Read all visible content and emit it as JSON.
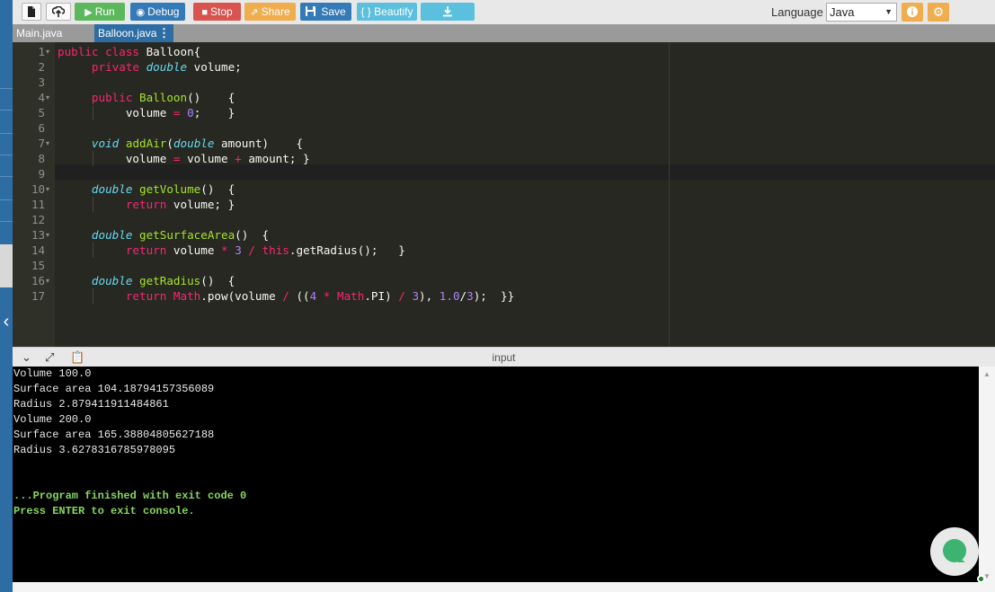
{
  "toolbar": {
    "new_file_icon": "file-icon",
    "upload_icon": "upload-icon",
    "run_label": "Run",
    "debug_label": "Debug",
    "stop_label": "Stop",
    "share_label": "Share",
    "save_label": "Save",
    "beautify_label": "{ } Beautify",
    "download_icon": "download-icon",
    "language_label": "Language",
    "language_value": "Java",
    "info_icon": "info-icon",
    "settings_icon": "gear-icon"
  },
  "tabs": [
    {
      "label": "Main.java",
      "active": false
    },
    {
      "label": "Balloon.java",
      "active": true
    }
  ],
  "editor": {
    "line_numbers": [
      "1",
      "2",
      "3",
      "4",
      "5",
      "6",
      "7",
      "8",
      "9",
      "10",
      "11",
      "12",
      "13",
      "14",
      "15",
      "16",
      "17"
    ],
    "active_line": 8
  },
  "console": {
    "title": "input",
    "output": [
      "Volume 100.0",
      "Surface area 104.18794157356089",
      "Radius 2.879411911484861",
      "Volume 200.0",
      "Surface area 165.38804805627188",
      "Radius 3.6278316785978095"
    ],
    "finished_message": "...Program finished with exit code 0",
    "exit_prompt": "Press ENTER to exit console."
  },
  "colors": {
    "run": "#5cb85c",
    "debug": "#337ab7",
    "stop": "#d9534f",
    "share": "#f0ad4e",
    "editor_bg": "#272822",
    "console_bg": "#000000",
    "success_text": "#86d65f"
  }
}
